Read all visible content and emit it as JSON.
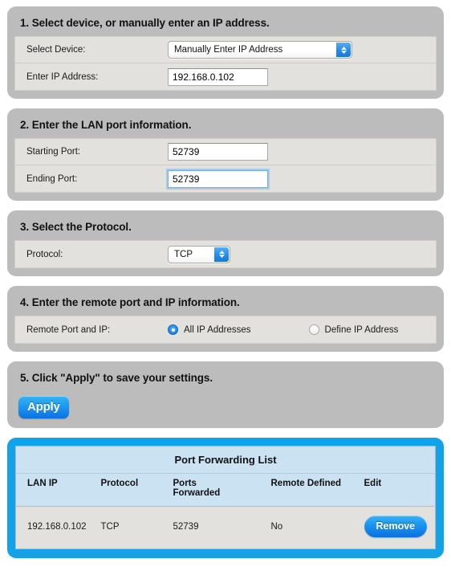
{
  "colors": {
    "panel_bg": "#bcbcbc",
    "row_bg": "#e2e1dd",
    "accent_blue": "#12a2e8",
    "table_header_bg": "#cbe2f3",
    "button_blue": "#1f9cf0"
  },
  "steps": [
    {
      "title": "1. Select device, or manually enter an IP address.",
      "rows": [
        {
          "label": "Select Device:",
          "control": "select",
          "value": "Manually Enter IP Address"
        },
        {
          "label": "Enter IP Address:",
          "control": "text",
          "value": "192.168.0.102"
        }
      ]
    },
    {
      "title": "2. Enter the LAN port information.",
      "rows": [
        {
          "label": "Starting Port:",
          "control": "text",
          "value": "52739"
        },
        {
          "label": "Ending Port:",
          "control": "text",
          "value": "52739",
          "focused": true
        }
      ]
    },
    {
      "title": "3. Select the Protocol.",
      "rows": [
        {
          "label": "Protocol:",
          "control": "select",
          "value": "TCP"
        }
      ]
    },
    {
      "title": "4. Enter the remote port and IP information.",
      "rows": [
        {
          "label": "Remote Port and IP:",
          "control": "radio",
          "options": [
            {
              "label": "All IP Addresses",
              "selected": true
            },
            {
              "label": "Define IP Address",
              "selected": false
            }
          ]
        }
      ]
    },
    {
      "title": "5. Click \"Apply\" to save your settings.",
      "apply_label": "Apply"
    }
  ],
  "list": {
    "title": "Port Forwarding List",
    "columns": [
      "LAN IP",
      "Protocol",
      "Ports Forwarded",
      "Remote Defined",
      "Edit"
    ],
    "column_lines": [
      [
        "LAN IP"
      ],
      [
        "Protocol"
      ],
      [
        "Ports",
        "Forwarded"
      ],
      [
        "Remote Defined"
      ],
      [
        "Edit"
      ]
    ],
    "rows": [
      {
        "lan_ip": "192.168.0.102",
        "protocol": "TCP",
        "ports_forwarded": "52739",
        "remote_defined": "No",
        "action_label": "Remove"
      }
    ]
  }
}
